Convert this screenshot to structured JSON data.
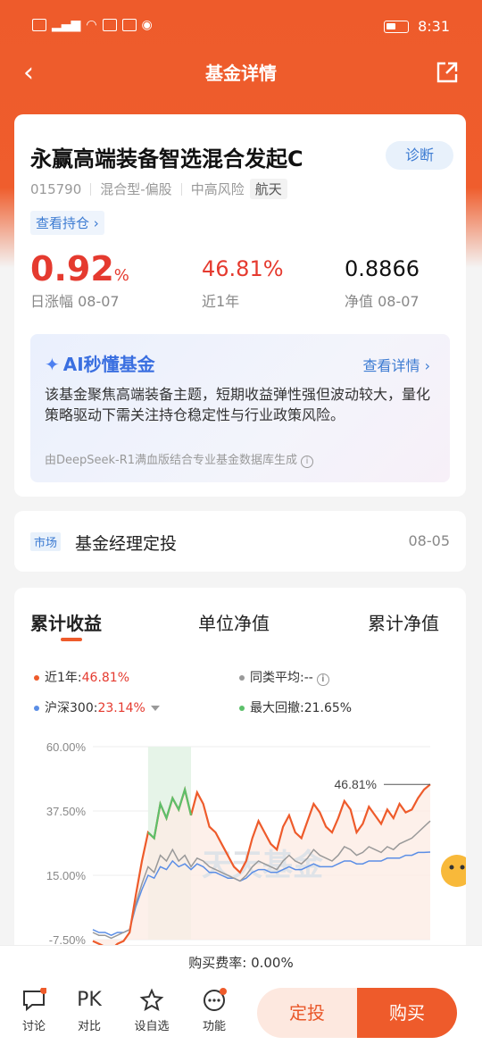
{
  "status": {
    "time": "8:31",
    "left_icons": "HD ⁵ᴳ"
  },
  "nav": {
    "title": "基金详情",
    "back": "‹"
  },
  "fund": {
    "name": "永赢高端装备智选混合发起C",
    "diagnose_label": "诊断",
    "code": "015790",
    "type": "混合型-偏股",
    "risk": "中高风险",
    "tag": "航天",
    "holding_link": "查看持仓 ›"
  },
  "stats": {
    "daily_value": "0.92",
    "daily_unit": "%",
    "daily_label": "日涨幅 08-07",
    "year_value": "46.81%",
    "year_label": "近1年",
    "nav_value": "0.8866",
    "nav_label": "净值 08-07"
  },
  "ai": {
    "title": "AI秒懂基金",
    "more": "查看详情 ›",
    "text": "该基金聚焦高端装备主题，短期收益弹性强但波动较大，量化策略驱动下需关注持仓稳定性与行业政策风险。",
    "footer": "由DeepSeek-R1满血版结合专业基金数据库生成"
  },
  "market": {
    "tag": "市场",
    "title": "基金经理定投",
    "date": "08-05"
  },
  "chart_tabs": [
    "累计收益",
    "单位净值",
    "累计净值"
  ],
  "legend": {
    "fund_label": "近1年:",
    "fund_value": "46.81%",
    "peer_label": "同类平均:--",
    "index_label": "沪深300:",
    "index_value": "23.14%",
    "drawdown_label": "最大回撤:21.65%"
  },
  "chart_data": {
    "type": "line",
    "y_ticks": [
      "60.00%",
      "37.50%",
      "15.00%",
      "-7.50%"
    ],
    "ylim": [
      -7.5,
      60
    ],
    "end_label": "46.81%",
    "watermark": "天天基金",
    "series": [
      {
        "name": "近1年",
        "color": "#ee5b2b",
        "values": [
          -8,
          -9,
          -10,
          -11,
          -9,
          -8,
          -5,
          8,
          20,
          30,
          28,
          40,
          35,
          42,
          38,
          45,
          36,
          44,
          40,
          32,
          30,
          26,
          22,
          18,
          16,
          20,
          28,
          34,
          30,
          26,
          24,
          32,
          36,
          30,
          28,
          34,
          40,
          37,
          32,
          30,
          35,
          41,
          38,
          30,
          33,
          39,
          36,
          33,
          38,
          35,
          40,
          37,
          38,
          42,
          45,
          46.81
        ]
      },
      {
        "name": "同类平均",
        "color": "#999999",
        "values": [
          -5,
          -6,
          -6,
          -7,
          -6,
          -5,
          -4,
          5,
          12,
          18,
          16,
          22,
          20,
          24,
          20,
          22,
          18,
          21,
          20,
          18,
          17,
          16,
          15,
          14,
          13,
          15,
          18,
          20,
          19,
          18,
          17,
          20,
          22,
          20,
          19,
          21,
          24,
          22,
          21,
          20,
          22,
          25,
          24,
          22,
          23,
          25,
          24,
          23,
          25,
          24,
          26,
          27,
          28,
          30,
          32,
          34
        ]
      },
      {
        "name": "沪深300",
        "color": "#5b8ee6",
        "values": [
          -4,
          -5,
          -5,
          -6,
          -5,
          -5,
          -4,
          4,
          10,
          15,
          14,
          18,
          17,
          20,
          18,
          19,
          17,
          19,
          18,
          16,
          16,
          15,
          14,
          14,
          13,
          14,
          16,
          17,
          17,
          16,
          16,
          17,
          18,
          17,
          17,
          18,
          19,
          18,
          18,
          18,
          19,
          20,
          20,
          19,
          19,
          20,
          20,
          20,
          21,
          21,
          21,
          22,
          22,
          23,
          23,
          23.14
        ]
      }
    ],
    "highlight_range": [
      9,
      16
    ]
  },
  "fee": "购买费率: 0.00%",
  "bottom": {
    "items": [
      {
        "label": "讨论",
        "icon": "chat-icon"
      },
      {
        "label": "对比",
        "icon": "pk-icon",
        "glyph": "PK"
      },
      {
        "label": "设自选",
        "icon": "star-plus-icon"
      },
      {
        "label": "功能",
        "icon": "more-icon"
      }
    ],
    "dingtou": "定投",
    "buy": "购买"
  }
}
